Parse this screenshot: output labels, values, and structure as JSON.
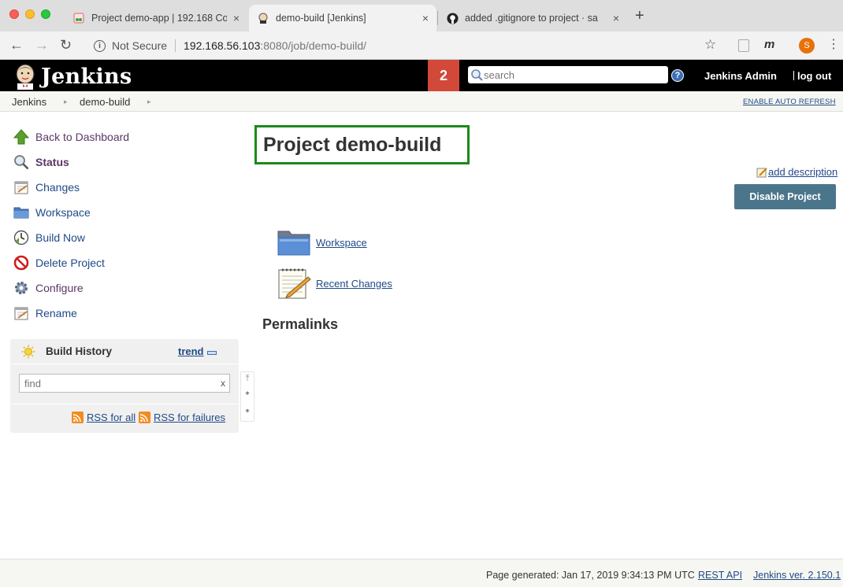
{
  "browser": {
    "tabs": [
      {
        "title": "Project demo-app | 192.168 Co",
        "favicon": "gitlab-icon"
      },
      {
        "title": "demo-build [Jenkins]",
        "favicon": "jenkins-icon"
      },
      {
        "title": "added .gitignore to project · sa",
        "favicon": "github-icon"
      }
    ],
    "close_glyph": "×",
    "new_tab_glyph": "+",
    "security_label": "Not Secure",
    "url_host": "192.168.56.103",
    "url_path": ":8080/job/demo-build/",
    "profile_initial": "S",
    "ext_label": "m"
  },
  "header": {
    "brand": "Jenkins",
    "notification_count": "2",
    "search_placeholder": "search",
    "help_glyph": "?",
    "user": "Jenkins Admin",
    "logout": "log out"
  },
  "breadcrumbs": {
    "items": [
      "Jenkins",
      "demo-build"
    ],
    "auto_refresh": "ENABLE AUTO REFRESH"
  },
  "sidebar": {
    "tasks": [
      {
        "label": "Back to Dashboard",
        "icon": "up-arrow-icon"
      },
      {
        "label": "Status",
        "icon": "magnifier-icon"
      },
      {
        "label": "Changes",
        "icon": "notepad-icon"
      },
      {
        "label": "Workspace",
        "icon": "folder-icon"
      },
      {
        "label": "Build Now",
        "icon": "clock-icon"
      },
      {
        "label": "Delete Project",
        "icon": "no-entry-icon"
      },
      {
        "label": "Configure",
        "icon": "gear-icon"
      },
      {
        "label": "Rename",
        "icon": "notepad-icon"
      }
    ],
    "build_history": {
      "title": "Build History",
      "trend": "trend",
      "find_placeholder": "find",
      "clear": "x",
      "rss_all": "RSS for all",
      "rss_failures": "RSS for failures"
    }
  },
  "main": {
    "title": "Project demo-build",
    "add_description": "add description",
    "disable_button": "Disable Project",
    "links": [
      {
        "label": "Workspace",
        "icon": "folder-icon"
      },
      {
        "label": "Recent Changes",
        "icon": "notepad-icon"
      }
    ],
    "permalinks_heading": "Permalinks"
  },
  "footer": {
    "generated": "Page generated: Jan 17, 2019 9:34:13 PM UTC",
    "rest_api": "REST API",
    "version": "Jenkins ver. 2.150.1"
  },
  "colors": {
    "jenkins_header": "#000000",
    "badge": "#d24939",
    "link": "#204a87",
    "sidebar_link": "#5c3566",
    "disable_button": "#4b758b",
    "title_highlight": "#1a8a1a"
  }
}
